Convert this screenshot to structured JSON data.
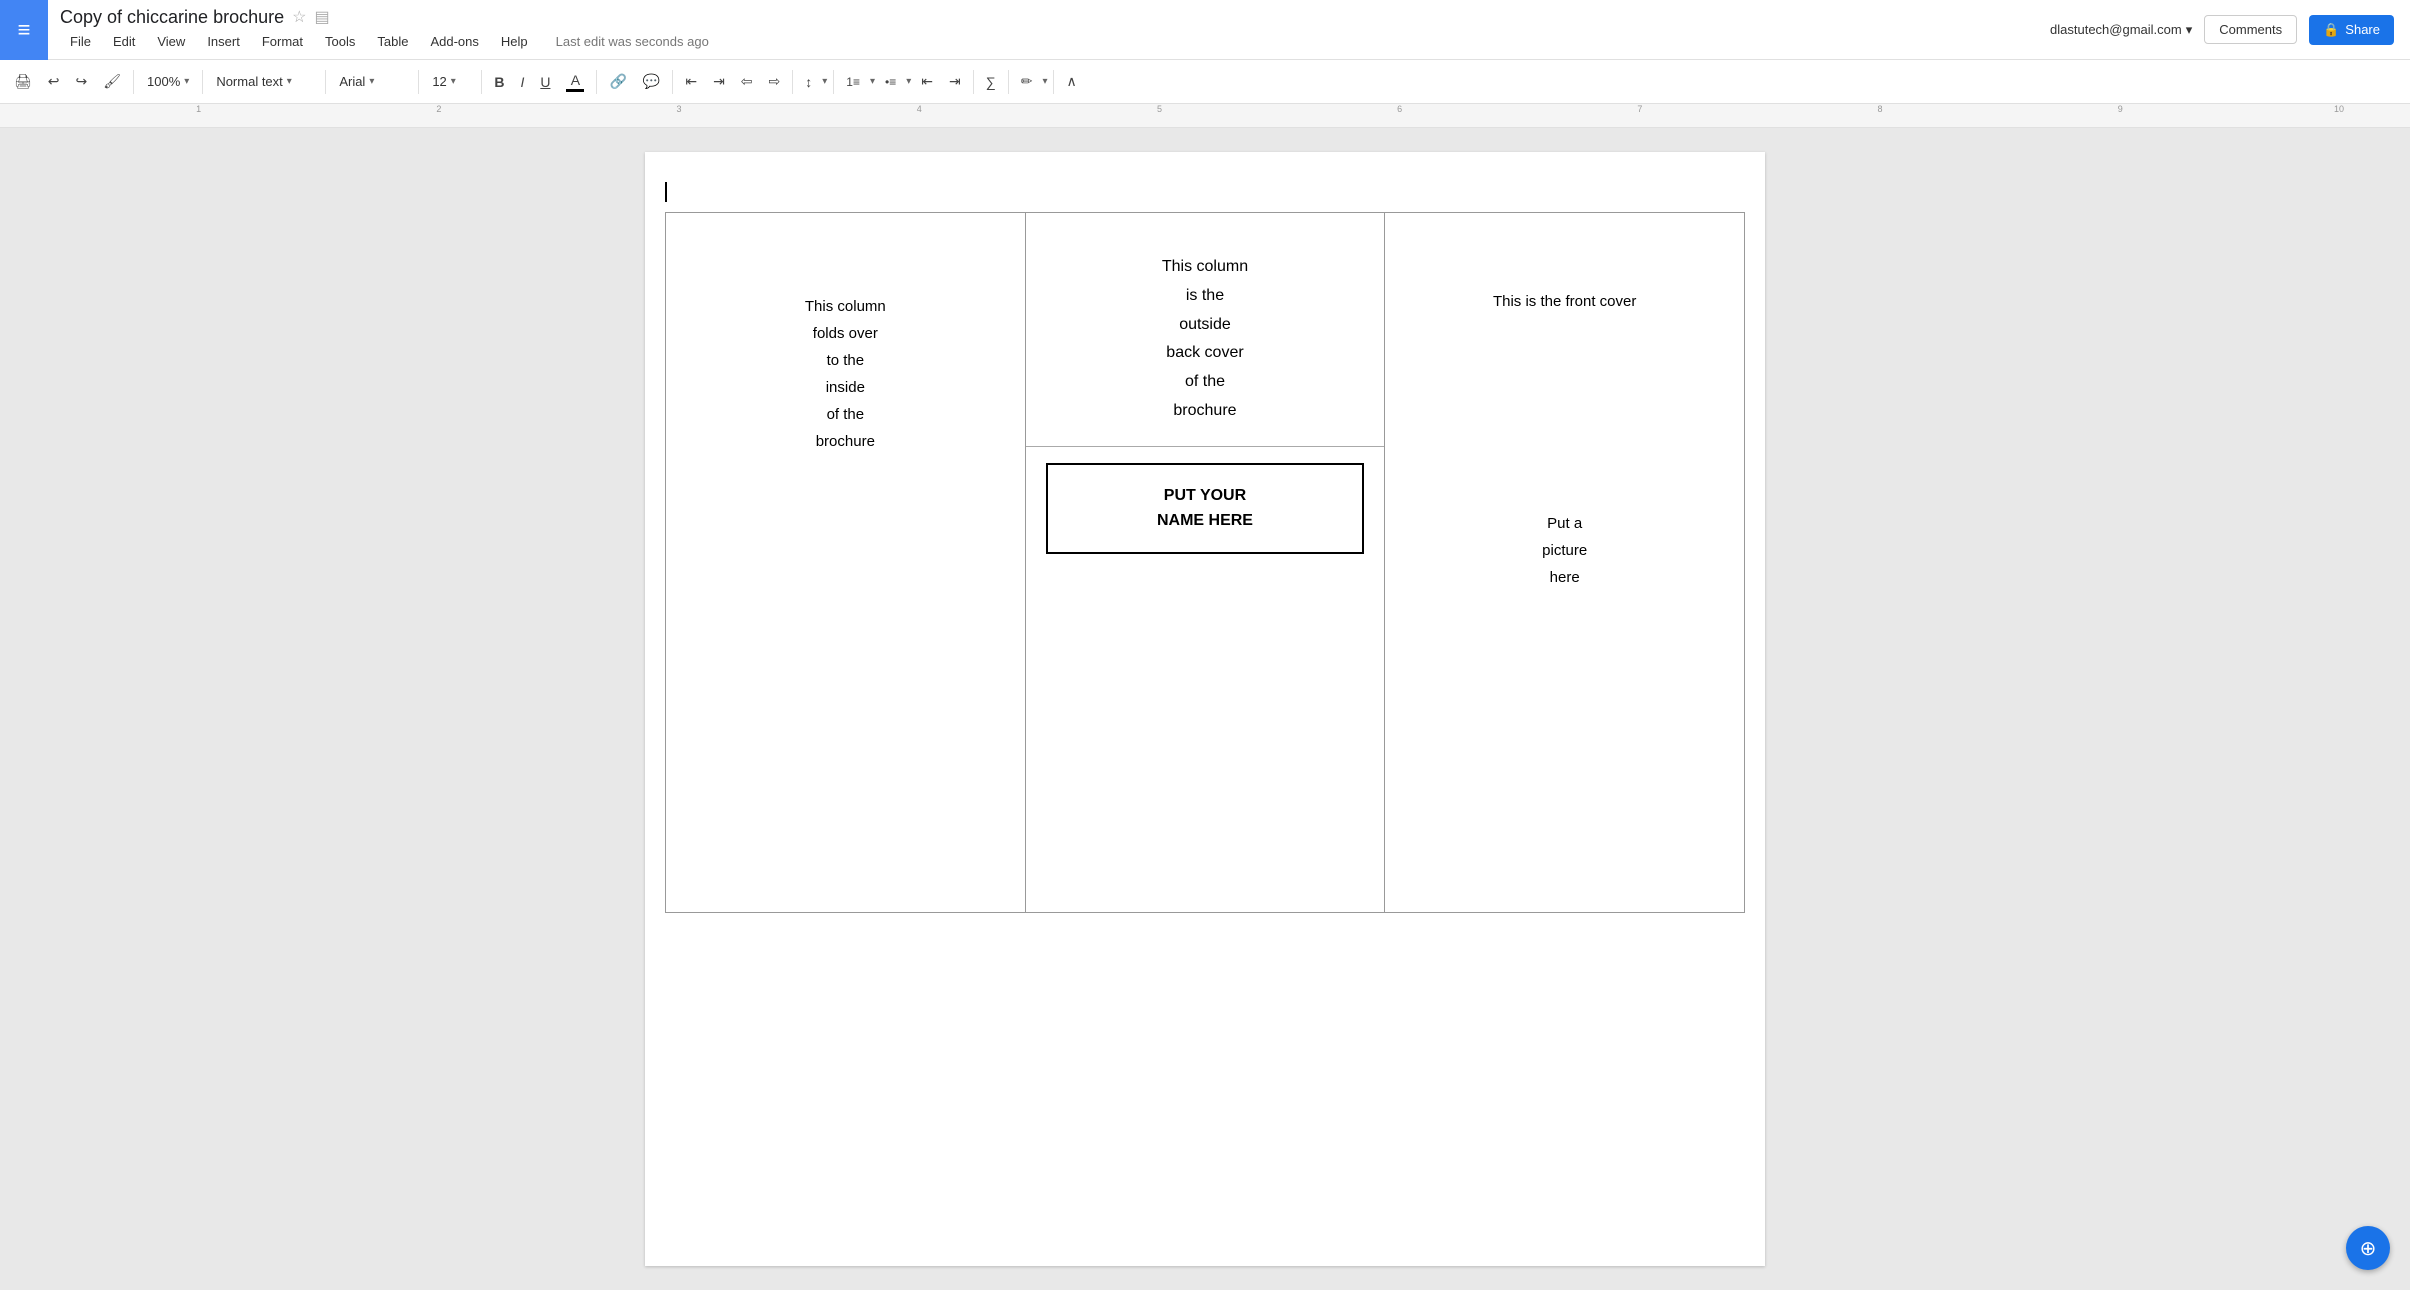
{
  "app": {
    "logo_icon": "≡",
    "doc_title": "Copy of chiccarine brochure",
    "star_icon": "☆",
    "folder_icon": "▤",
    "user_email": "dlastutech@gmail.com",
    "email_arrow": "▾",
    "last_edit": "Last edit was seconds ago",
    "comments_label": "Comments",
    "share_label": "Share",
    "lock_icon": "🔒"
  },
  "toolbar": {
    "print_icon": "🖨",
    "undo_icon": "↩",
    "redo_icon": "↪",
    "paintformat_icon": "🖌",
    "zoom": "100%",
    "zoom_arrow": "▾",
    "style": "Normal text",
    "style_arrow": "▾",
    "font": "Arial",
    "font_arrow": "▾",
    "font_size": "12",
    "size_arrow": "▾",
    "bold": "B",
    "italic": "I",
    "underline": "U",
    "text_color": "A",
    "link_icon": "🔗",
    "comment_icon": "💬",
    "align_left": "≡",
    "align_center": "≡",
    "align_right": "≡",
    "align_justify": "≡",
    "line_spacing_icon": "↕",
    "numbered_list_icon": "≡",
    "bullet_list_icon": "≡",
    "indent_less_icon": "⇤",
    "indent_more_icon": "⇥",
    "formula_icon": "∑",
    "pen_icon": "✏",
    "collapse_icon": "∧"
  },
  "document": {
    "col1_text": "This column\nfolds over\nto the\ninside\nof the\nbrochure",
    "col2_top_text": "This column\nis the\noutside\nback cover\nof the\nbrochure",
    "col2_name_line1": "PUT YOUR",
    "col2_name_line2": "NAME HERE",
    "col3_title": "This is the front cover",
    "col3_picture": "Put a\npicture\nhere"
  }
}
